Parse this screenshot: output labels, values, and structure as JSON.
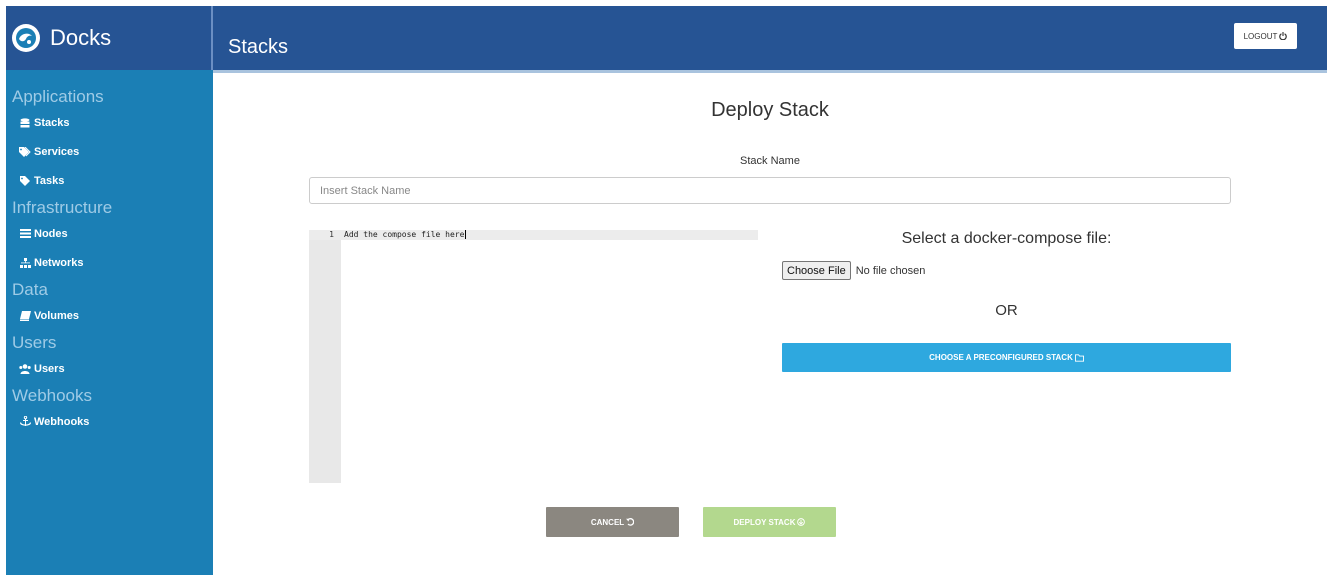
{
  "brand": {
    "name": "Docks",
    "logo_icon": "docks-logo-icon"
  },
  "header": {
    "title": "Stacks",
    "logout_label": "LOGOUT",
    "logout_icon": "power-icon"
  },
  "sidebar": {
    "sections": [
      {
        "title": "Applications",
        "items": [
          {
            "label": "Stacks",
            "icon": "database-icon"
          },
          {
            "label": "Services",
            "icon": "tags-icon"
          },
          {
            "label": "Tasks",
            "icon": "tag-icon"
          }
        ]
      },
      {
        "title": "Infrastructure",
        "items": [
          {
            "label": "Nodes",
            "icon": "list-icon"
          },
          {
            "label": "Networks",
            "icon": "sitemap-icon"
          }
        ]
      },
      {
        "title": "Data",
        "items": [
          {
            "label": "Volumes",
            "icon": "book-icon"
          }
        ]
      },
      {
        "title": "Users",
        "items": [
          {
            "label": "Users",
            "icon": "users-icon"
          }
        ]
      },
      {
        "title": "Webhooks",
        "items": [
          {
            "label": "Webhooks",
            "icon": "anchor-icon"
          }
        ]
      }
    ]
  },
  "main": {
    "title": "Deploy Stack",
    "stack_name_label": "Stack Name",
    "stack_name_placeholder": "Insert Stack Name",
    "stack_name_value": "",
    "editor": {
      "line_number": "1",
      "line_text": "Add the compose file here"
    },
    "compose_title": "Select a docker-compose file:",
    "choose_file_label": "Choose File",
    "file_status": "No file chosen",
    "or_text": "OR",
    "preconfigured_label": "CHOOSE A PRECONFIGURED STACK",
    "cancel_label": "CANCEL",
    "deploy_label": "DEPLOY STACK"
  },
  "colors": {
    "header": "#265494",
    "sidebar": "#1b7fb5",
    "section_title": "#9fcbe6",
    "preconfigured": "#2ea8df",
    "cancel": "#8b8780",
    "deploy_disabled": "#b3d88e"
  }
}
